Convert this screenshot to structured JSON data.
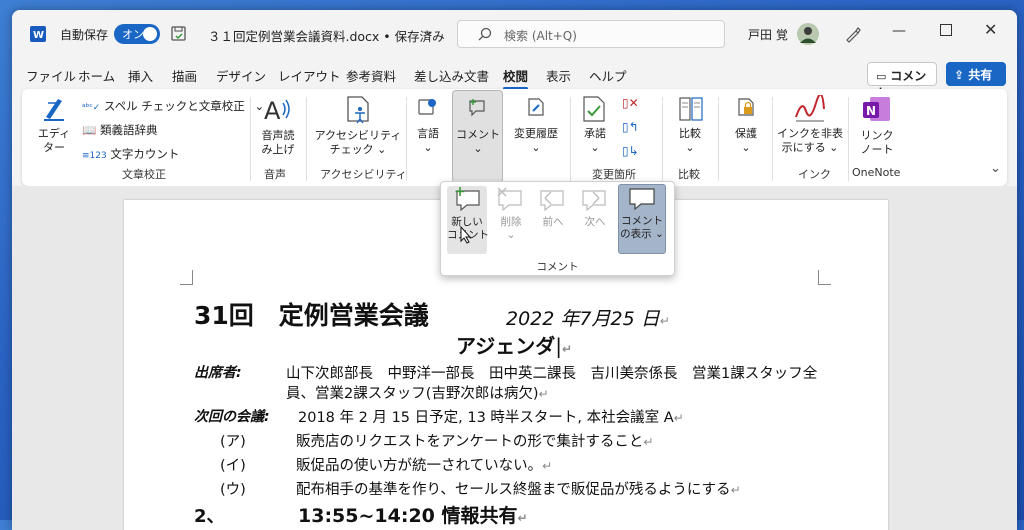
{
  "titlebar": {
    "autosave_label": "自動保存",
    "autosave_state": "オン",
    "doc_title": "３１回定例営業会議資料.docx • 保存済み",
    "search_placeholder": "検索 (Alt+Q)",
    "user_name": "戸田 覚"
  },
  "menu": {
    "tabs": [
      "ファイル",
      "ホーム",
      "挿入",
      "描画",
      "デザイン",
      "レイアウト",
      "参考資料",
      "差し込み文書",
      "校閲",
      "表示",
      "ヘルプ"
    ],
    "active_tab": "校閲",
    "comment_button": "コメント",
    "share_button": "共有"
  },
  "ribbon": {
    "editor": "エディ\nター",
    "spell": "スペル チェックと文章校正",
    "thesaurus": "類義語辞典",
    "wordcount": "文字カウント",
    "group_proofing": "文章校正",
    "read_aloud": "音声読\nみ上げ",
    "group_speech": "音声",
    "accessibility": "アクセシビリティ\nチェック ⌄",
    "group_accessibility": "アクセシビリティ",
    "language": "言語\n⌄",
    "comment": "コメント\n⌄",
    "track_changes": "変更履歴\n⌄",
    "accept": "承諾\n⌄",
    "group_changes": "変更箇所",
    "compare": "比較\n⌄",
    "group_compare": "比較",
    "protect": "保護\n⌄",
    "ink_hide": "インクを非表\n示にする ⌄",
    "group_ink": "インク",
    "link_note": "リンク\nノート",
    "group_onenote": "OneNote"
  },
  "popup": {
    "new_comment": "新しい\nコメント",
    "delete": "削除\n⌄",
    "prev": "前へ",
    "next": "次へ",
    "show_comments": "コメント\nの表示 ⌄",
    "group_label": "コメント"
  },
  "document": {
    "heading": "31回　定例営業会議",
    "date": "2022 年7月25 日",
    "subtitle": "アジェンダ",
    "attendees_label": "出席者:",
    "attendees_1": "山下次郎部長　中野洋一部長　田中英二課長　吉川美奈係長　営業1課スタッフ全",
    "attendees_2": "員、営業2課スタッフ(吉野次郎は病欠)",
    "next_meeting_label": "次回の会議:",
    "next_meeting": "2018 年 2 月 15 日予定, 13 時半スタート, 本社会議室 A",
    "item_a_label": "(ア)",
    "item_a": "販売店のリクエストをアンケートの形で集計すること",
    "item_i_label": "(イ)",
    "item_i": "販促品の使い方が統一されていない。",
    "item_u_label": "(ウ)",
    "item_u": "配布相手の基準を作り、セールス終盤まで販促品が残るようにする",
    "section2_num": "2、",
    "section2": "13:55~14:20 情報共有"
  },
  "colors": {
    "accent": "#1a66c5",
    "ink": "#c0282d",
    "onenote": "#7719aa"
  }
}
